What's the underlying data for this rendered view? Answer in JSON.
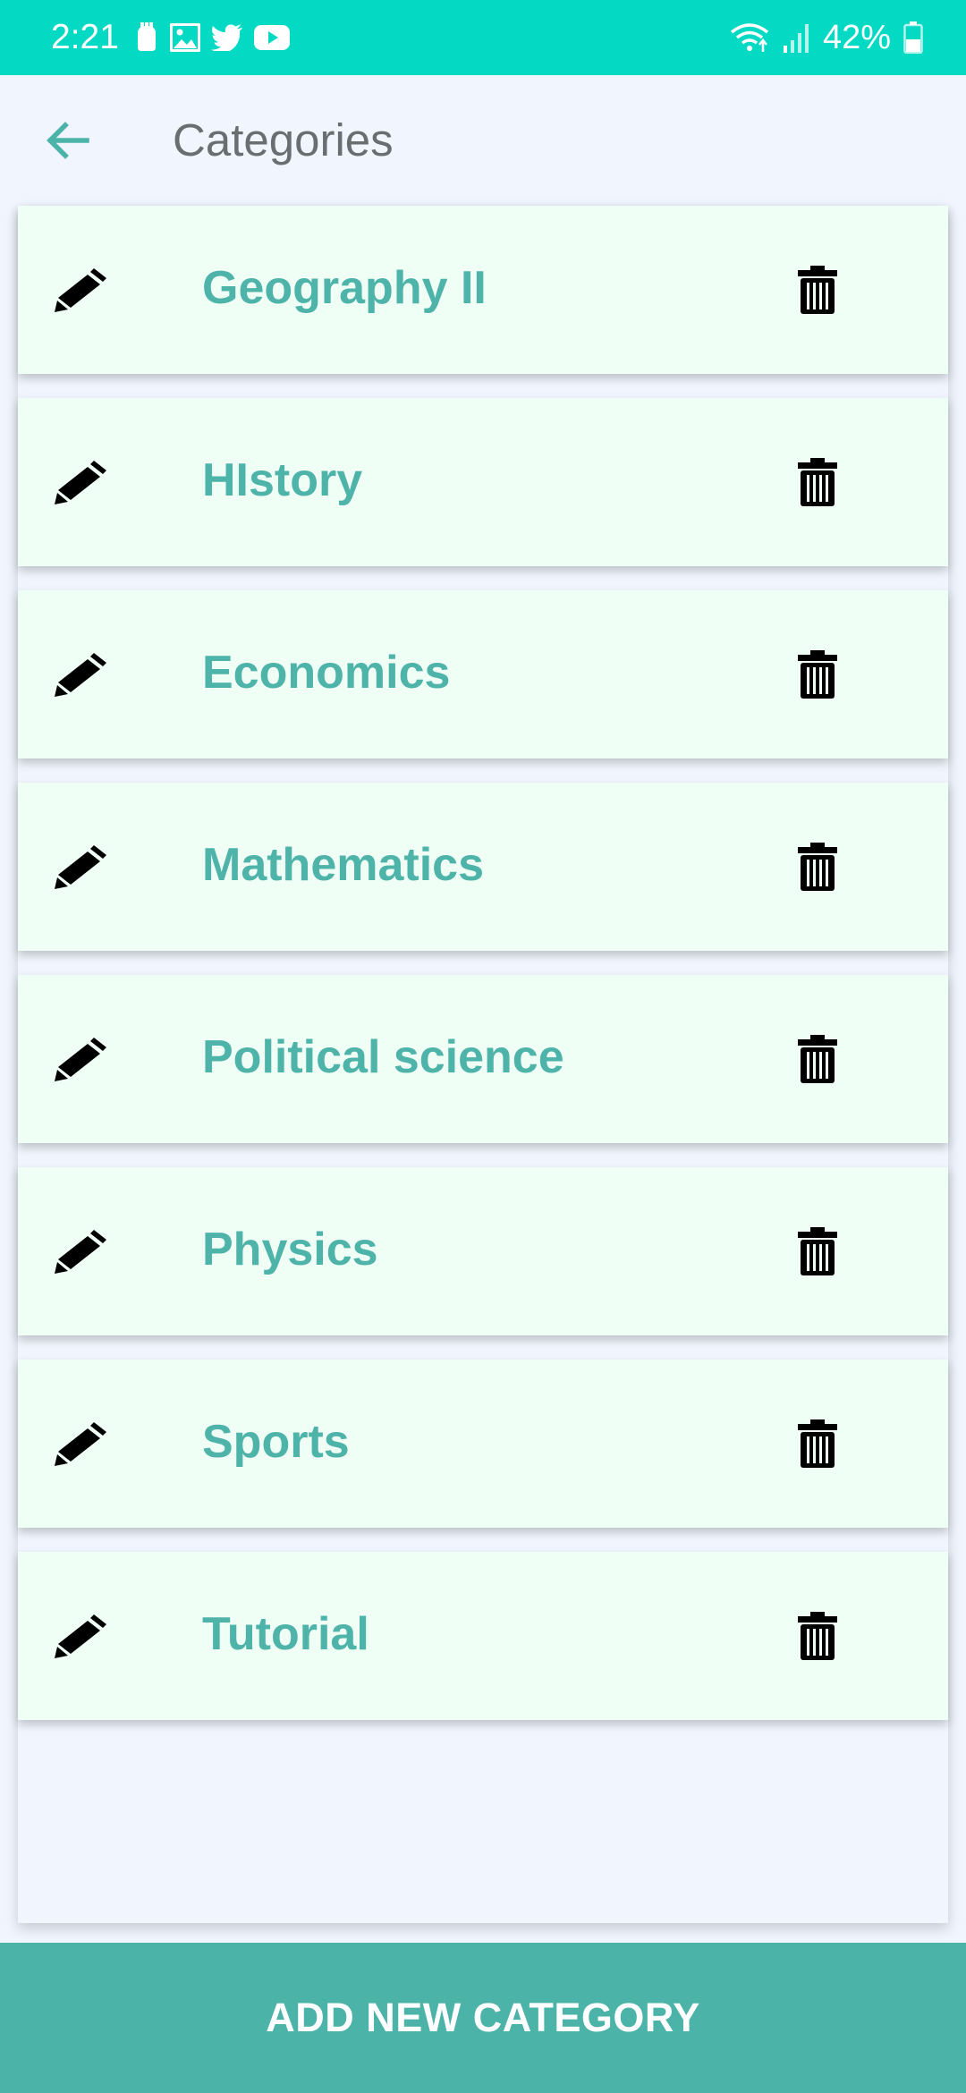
{
  "status_bar": {
    "time": "2:21",
    "battery": "42%",
    "icons": [
      "notification-icon",
      "image-icon",
      "twitter-icon",
      "youtube-icon",
      "wifi-icon",
      "signal-icon",
      "battery-icon"
    ]
  },
  "app_bar": {
    "title": "Categories",
    "back_icon": "arrow-left-icon"
  },
  "categories": [
    {
      "name": "Geography II"
    },
    {
      "name": "HIstory"
    },
    {
      "name": "Economics"
    },
    {
      "name": "Mathematics"
    },
    {
      "name": "Political science"
    },
    {
      "name": "Physics"
    },
    {
      "name": "Sports"
    },
    {
      "name": "Tutorial"
    }
  ],
  "row_icons": {
    "edit": "pencil-icon",
    "delete": "trash-icon"
  },
  "add_button": {
    "label": "ADD NEW CATEGORY"
  },
  "colors": {
    "status_bar": "#04d9c4",
    "accent": "#4bb3a8",
    "category_text": "#4eb3a9",
    "card_background": "#f0fff6",
    "page_background": "#f1f6fe",
    "title_text": "#6b6e70"
  }
}
